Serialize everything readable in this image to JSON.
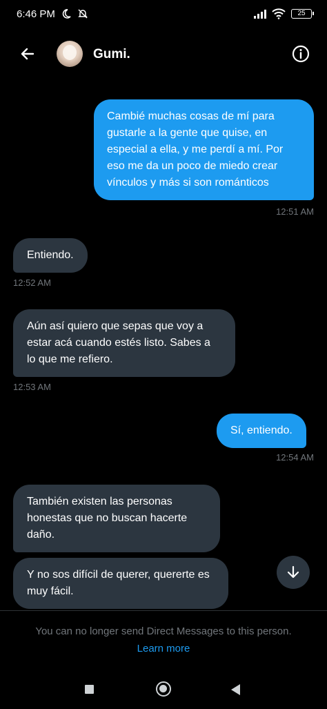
{
  "status_bar": {
    "time": "6:46 PM",
    "battery": "25"
  },
  "header": {
    "contact_name": "Gumi.",
    "back_icon": "arrow-left-icon",
    "info_icon": "info-icon"
  },
  "messages": [
    {
      "direction": "out",
      "text": "Cambié muchas cosas de mí para gustarle a la gente que quise, en especial a ella, y me perdí a mí. Por eso me da un poco de miedo crear vínculos y más si son románticos",
      "time": "12:51 AM"
    },
    {
      "direction": "in",
      "text": "Entiendo.",
      "time": "12:52 AM"
    },
    {
      "direction": "in",
      "text": "Aún así quiero que sepas que voy a estar acá cuando estés listo. Sabes a lo que me refiero.",
      "time": "12:53 AM"
    },
    {
      "direction": "out",
      "text": "Sí, entiendo.",
      "time": "12:54 AM"
    },
    {
      "direction": "in",
      "text": "También existen las personas honestas que no buscan hacerte daño.",
      "time": ""
    },
    {
      "direction": "in",
      "text": "Y no sos difícil de querer, quererte es muy fácil.",
      "time": ""
    }
  ],
  "footer": {
    "notice": "You can no longer send Direct Messages to this person.",
    "learn_more": "Learn more"
  },
  "colors": {
    "accent": "#1d9bf0",
    "incoming_bubble": "#2c3640",
    "background": "#000000"
  }
}
